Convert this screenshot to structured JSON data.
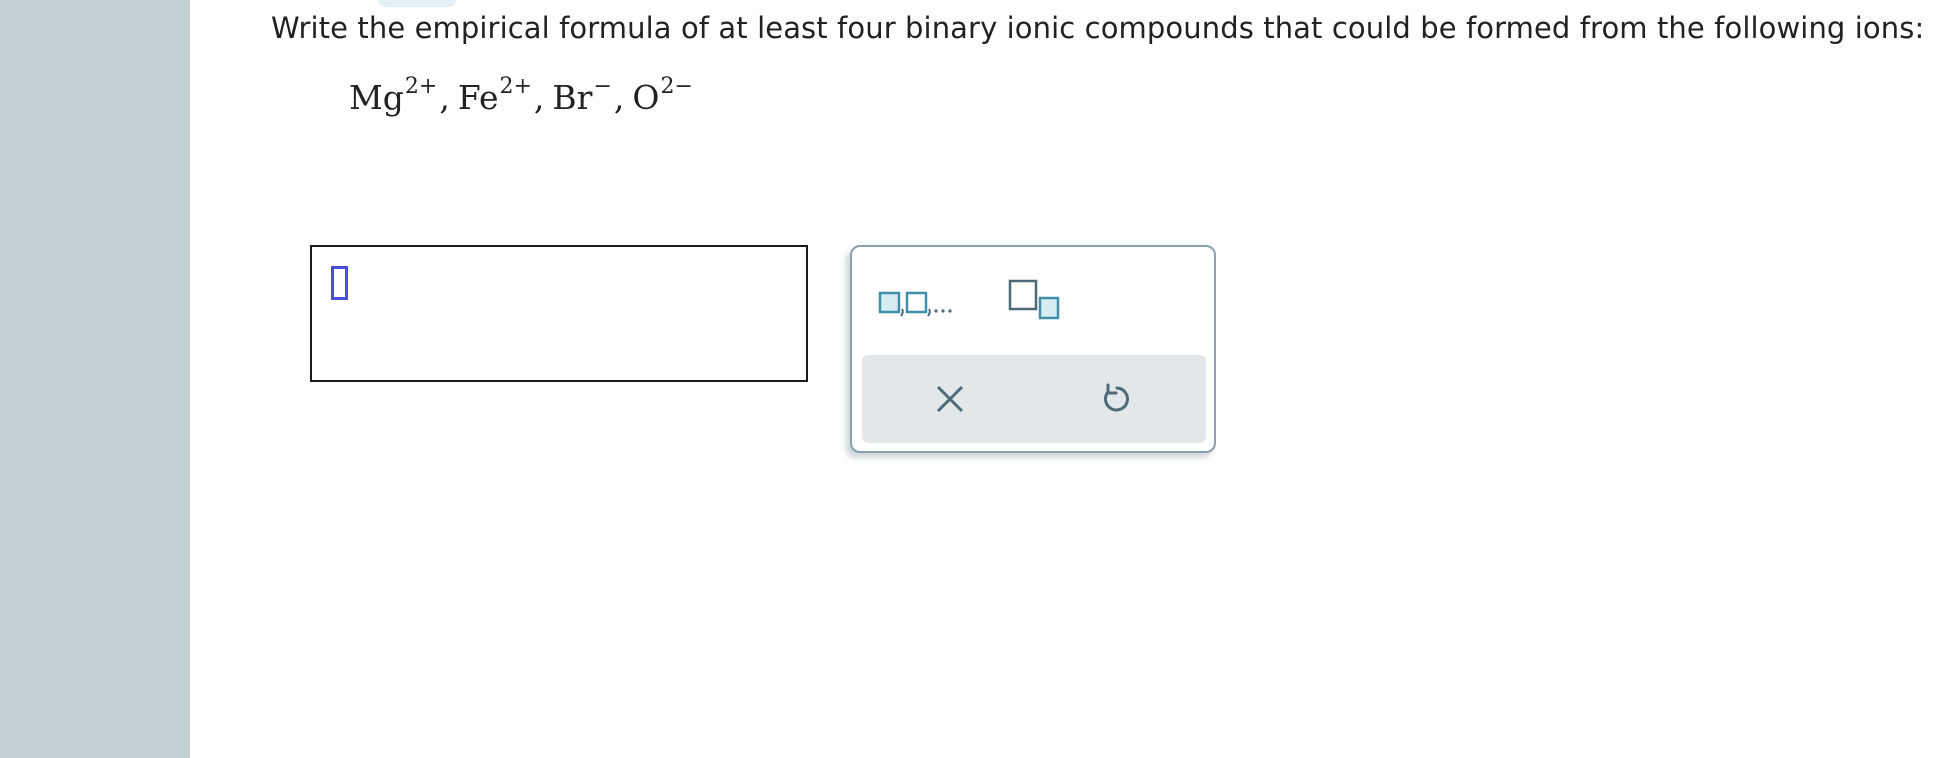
{
  "question": {
    "text": "Write the empirical formula of at least four binary ionic compounds that could be formed from the following ions:"
  },
  "ions": [
    {
      "symbol": "Mg",
      "charge": "2+"
    },
    {
      "symbol": "Fe",
      "charge": "2+"
    },
    {
      "symbol": "Br",
      "charge": "−"
    },
    {
      "symbol": "O",
      "charge": "2−"
    }
  ],
  "separator": ",",
  "palette": {
    "list_button_icon": "comma-list-icon",
    "subscript_button_icon": "subscript-icon",
    "clear_button_icon": "x-icon",
    "undo_button_icon": "undo-icon"
  },
  "colors": {
    "rail": "#c5d0d5",
    "accent": "#3e8fa8",
    "cursor": "#4a4fd9",
    "icon": "#4f6a77"
  }
}
